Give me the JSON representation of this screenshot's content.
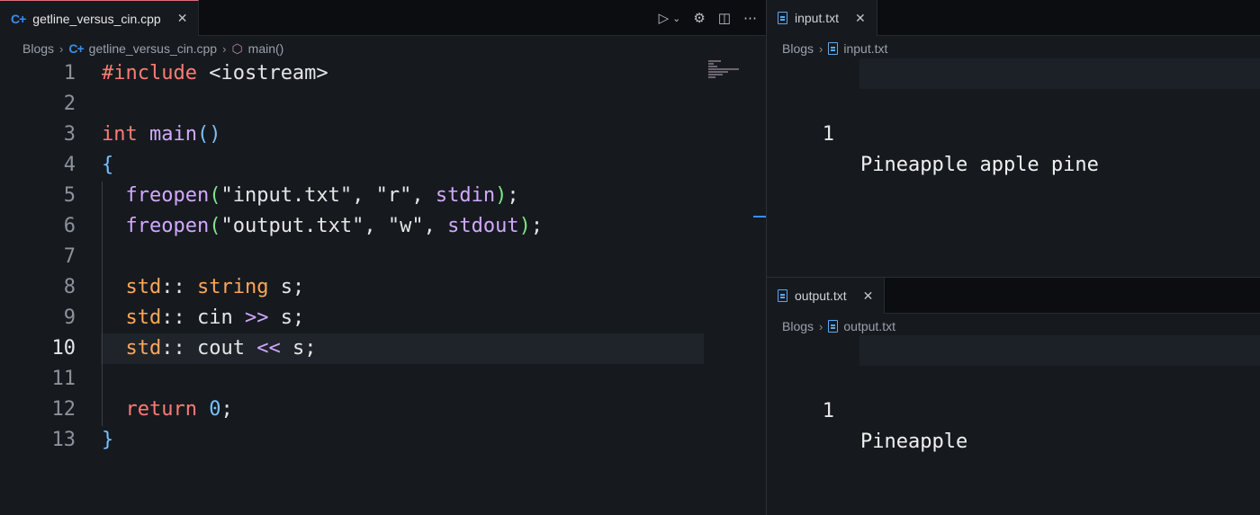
{
  "editor": {
    "tab_label": "getline_versus_cin.cpp",
    "tab_close": "✕",
    "breadcrumb": [
      "Blogs",
      "getline_versus_cin.cpp",
      "main()"
    ],
    "actions": [
      "run-debug-icon",
      "dropdown-chevron-icon",
      "settings-gear-icon",
      "split-editor-icon",
      "more-actions-icon"
    ],
    "current_line": 10,
    "lines": [
      {
        "n": "1",
        "tokens": [
          [
            "pp",
            "#include"
          ],
          [
            "plain",
            " "
          ],
          [
            "plain",
            "<iostream>"
          ]
        ]
      },
      {
        "n": "2",
        "tokens": []
      },
      {
        "n": "3",
        "tokens": [
          [
            "kw",
            "int"
          ],
          [
            "plain",
            " "
          ],
          [
            "fn",
            "main"
          ],
          [
            "br",
            "()"
          ]
        ]
      },
      {
        "n": "4",
        "tokens": [
          [
            "br",
            "{"
          ]
        ]
      },
      {
        "n": "5",
        "tokens": [
          [
            "plain",
            "  "
          ],
          [
            "fn",
            "freopen"
          ],
          [
            "p2",
            "("
          ],
          [
            "str",
            "\"input.txt\""
          ],
          [
            "plain",
            ", "
          ],
          [
            "str",
            "\"r\""
          ],
          [
            "plain",
            ", "
          ],
          [
            "var",
            "stdin"
          ],
          [
            "p2",
            ")"
          ],
          [
            "plain",
            ";"
          ]
        ]
      },
      {
        "n": "6",
        "tokens": [
          [
            "plain",
            "  "
          ],
          [
            "fn",
            "freopen"
          ],
          [
            "p2",
            "("
          ],
          [
            "str",
            "\"output.txt\""
          ],
          [
            "plain",
            ", "
          ],
          [
            "str",
            "\"w\""
          ],
          [
            "plain",
            ", "
          ],
          [
            "var",
            "stdout"
          ],
          [
            "p2",
            ")"
          ],
          [
            "plain",
            ";"
          ]
        ]
      },
      {
        "n": "7",
        "tokens": []
      },
      {
        "n": "8",
        "tokens": [
          [
            "plain",
            "  "
          ],
          [
            "ns",
            "std"
          ],
          [
            "plain",
            ":: "
          ],
          [
            "type",
            "string"
          ],
          [
            "plain",
            " s;"
          ]
        ]
      },
      {
        "n": "9",
        "tokens": [
          [
            "plain",
            "  "
          ],
          [
            "ns",
            "std"
          ],
          [
            "plain",
            ":: cin "
          ],
          [
            "op",
            ">>"
          ],
          [
            "plain",
            " s;"
          ]
        ]
      },
      {
        "n": "10",
        "tokens": [
          [
            "plain",
            "  "
          ],
          [
            "ns",
            "std"
          ],
          [
            "plain",
            ":: cout "
          ],
          [
            "op",
            "<<"
          ],
          [
            "plain",
            " s;"
          ]
        ]
      },
      {
        "n": "11",
        "tokens": []
      },
      {
        "n": "12",
        "tokens": [
          [
            "plain",
            "  "
          ],
          [
            "kw",
            "return"
          ],
          [
            "plain",
            " "
          ],
          [
            "num",
            "0"
          ],
          [
            "plain",
            ";"
          ]
        ]
      },
      {
        "n": "13",
        "tokens": [
          [
            "br",
            "}"
          ]
        ]
      }
    ]
  },
  "input_pane": {
    "tab_label": "input.txt",
    "tab_close": "✕",
    "breadcrumb": [
      "Blogs",
      "input.txt"
    ],
    "lines": [
      {
        "n": "1",
        "text": "Pineapple apple pine"
      }
    ]
  },
  "output_pane": {
    "tab_label": "output.txt",
    "tab_close": "✕",
    "breadcrumb": [
      "Blogs",
      "output.txt"
    ],
    "lines": [
      {
        "n": "1",
        "text": "Pineapple"
      }
    ]
  },
  "colors": {
    "background": "#161a1f",
    "tabbar": "#0b0d10",
    "active_tab_border": "#e06c75",
    "keyword": "#ff7b72",
    "function": "#d2a8ff",
    "namespace": "#ffa657",
    "number": "#79c0ff"
  }
}
